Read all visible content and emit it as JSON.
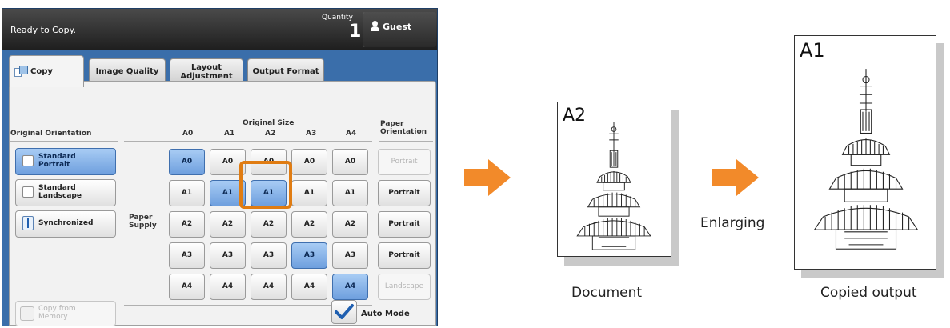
{
  "status": {
    "text": "Ready to Copy.",
    "quantity_label": "Quantity",
    "quantity_value": "1",
    "user_label": "Guest"
  },
  "tabs": [
    {
      "label": "Copy"
    },
    {
      "label": "Image Quality"
    },
    {
      "label": "Layout\nAdjustment"
    },
    {
      "label": "Output Format"
    }
  ],
  "panel": {
    "orientation_header": "Original Orientation",
    "original_size_header": "Original Size",
    "paper_orientation_header": "Paper\nOrientation",
    "paper_supply_label": "Paper\nSupply",
    "orientation_buttons": [
      {
        "label": "Standard\nPortrait"
      },
      {
        "label": "Standard\nLandscape"
      },
      {
        "label": "Synchronized"
      }
    ],
    "column_headers": [
      "A0",
      "A1",
      "A2",
      "A3",
      "A4"
    ],
    "rows": [
      {
        "cells": [
          "A0",
          "A0",
          "A0",
          "A0",
          "A0"
        ],
        "orientation": "Portrait"
      },
      {
        "cells": [
          "A1",
          "A1",
          "A1",
          "A1",
          "A1"
        ],
        "orientation": "Portrait"
      },
      {
        "cells": [
          "A2",
          "A2",
          "A2",
          "A2",
          "A2"
        ],
        "orientation": "Portrait"
      },
      {
        "cells": [
          "A3",
          "A3",
          "A3",
          "A3",
          "A3"
        ],
        "orientation": "Portrait"
      },
      {
        "cells": [
          "A4",
          "A4",
          "A4",
          "A4",
          "A4"
        ],
        "orientation": "Landscape"
      }
    ],
    "copy_from_memory": "Copy from\nMemory",
    "auto_mode": "Auto Mode"
  },
  "illustration": {
    "document_size": "A2",
    "output_size": "A1",
    "enlarging_label": "Enlarging",
    "document_caption": "Document",
    "output_caption": "Copied output"
  },
  "colors": {
    "accent": "#F28A2A",
    "highlight": "#E07C12",
    "selected": "#7AA8E4",
    "panel_blue": "#3A6EAA"
  }
}
